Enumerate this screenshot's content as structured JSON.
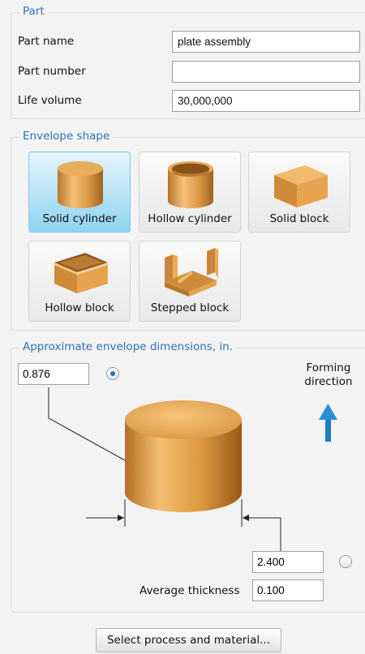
{
  "part": {
    "title": "Part",
    "fields": [
      {
        "label": "Part name",
        "value": "plate assembly"
      },
      {
        "label": "Part number",
        "value": ""
      },
      {
        "label": "Life volume",
        "value": "30,000,000"
      }
    ]
  },
  "envelope": {
    "title": "Envelope shape",
    "shapes": [
      {
        "label": "Solid cylinder",
        "selected": true
      },
      {
        "label": "Hollow cylinder",
        "selected": false
      },
      {
        "label": "Solid block",
        "selected": false
      },
      {
        "label": "Hollow block",
        "selected": false
      },
      {
        "label": "Stepped block",
        "selected": false
      }
    ]
  },
  "dimensions": {
    "title": "Approximate envelope dimensions, in.",
    "height_value": "0.876",
    "height_radio_selected": true,
    "diameter_value": "2.400",
    "diameter_radio_selected": false,
    "avg_thickness_label": "Average thickness",
    "avg_thickness_value": "0.100",
    "forming_line1": "Forming",
    "forming_line2": "direction"
  },
  "actions": {
    "select_button": "Select process and material..."
  },
  "colors": {
    "accent": "#2f6fba",
    "selected_tile": "#8fd3f0",
    "shape_gold": "#e3a64f",
    "arrow": "#1d7ec0"
  }
}
